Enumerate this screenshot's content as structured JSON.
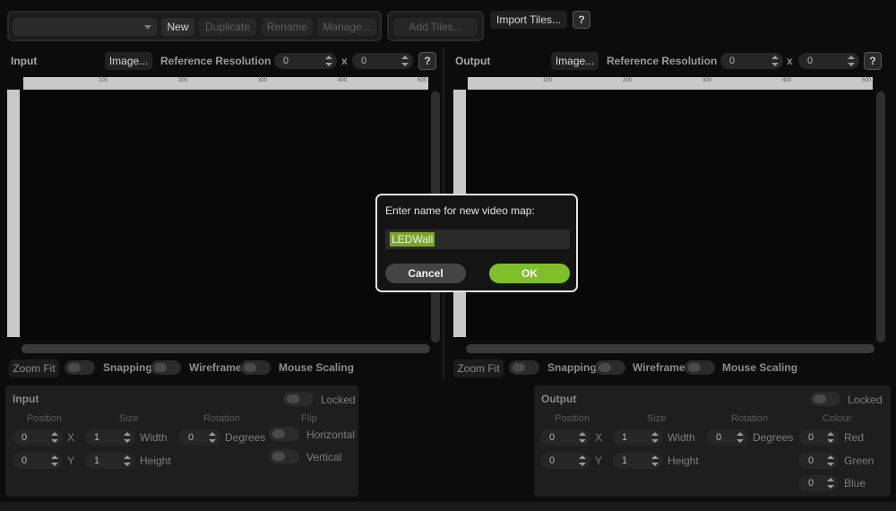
{
  "toolbar": {
    "map_select_value": "",
    "new_label": "New",
    "duplicate_label": "Duplicate",
    "rename_label": "Rename",
    "manage_label": "Manage...",
    "add_tiles_label": "Add Tiles...",
    "import_tiles_label": "Import Tiles...",
    "help_label": "?"
  },
  "input_panel": {
    "title": "Input",
    "image_button": "Image...",
    "ref_res_label": "Reference Resolution",
    "ref_width": "0",
    "ref_x": "x",
    "ref_height": "0",
    "help_label": "?",
    "ruler_ticks": [
      "100",
      "200",
      "300",
      "400",
      "500"
    ],
    "zoom_fit": "Zoom Fit",
    "snapping": "Snapping",
    "wireframe": "Wireframe",
    "mouse_scaling": "Mouse Scaling"
  },
  "output_panel": {
    "title": "Output",
    "image_button": "Image...",
    "ref_res_label": "Reference Resolution",
    "ref_width": "0",
    "ref_x": "x",
    "ref_height": "0",
    "help_label": "?",
    "ruler_ticks": [
      "100",
      "200",
      "300",
      "400",
      "500"
    ],
    "zoom_fit": "Zoom Fit",
    "snapping": "Snapping",
    "wireframe": "Wireframe",
    "mouse_scaling": "Mouse Scaling"
  },
  "input_props": {
    "title": "Input",
    "locked": "Locked",
    "position_hdr": "Position",
    "size_hdr": "Size",
    "rotation_hdr": "Rotation",
    "flip_hdr": "Flip",
    "pos_x": "0",
    "pos_x_label": "X",
    "pos_y": "0",
    "pos_y_label": "Y",
    "width": "1",
    "width_label": "Width",
    "height": "1",
    "height_label": "Height",
    "rotation": "0",
    "degrees_label": "Degrees",
    "horizontal_label": "Horizontal",
    "vertical_label": "Vertical"
  },
  "output_props": {
    "title": "Output",
    "locked": "Locked",
    "position_hdr": "Position",
    "size_hdr": "Size",
    "rotation_hdr": "Rotation",
    "colour_hdr": "Colour",
    "pos_x": "0",
    "pos_x_label": "X",
    "pos_y": "0",
    "pos_y_label": "Y",
    "width": "1",
    "width_label": "Width",
    "height": "1",
    "height_label": "Height",
    "rotation": "0",
    "degrees_label": "Degrees",
    "red": "0",
    "red_label": "Red",
    "green": "0",
    "green_label": "Green",
    "blue": "0",
    "blue_label": "Blue"
  },
  "dialog": {
    "prompt": "Enter name for new video map:",
    "value": "LEDWall",
    "cancel": "Cancel",
    "ok": "OK"
  }
}
